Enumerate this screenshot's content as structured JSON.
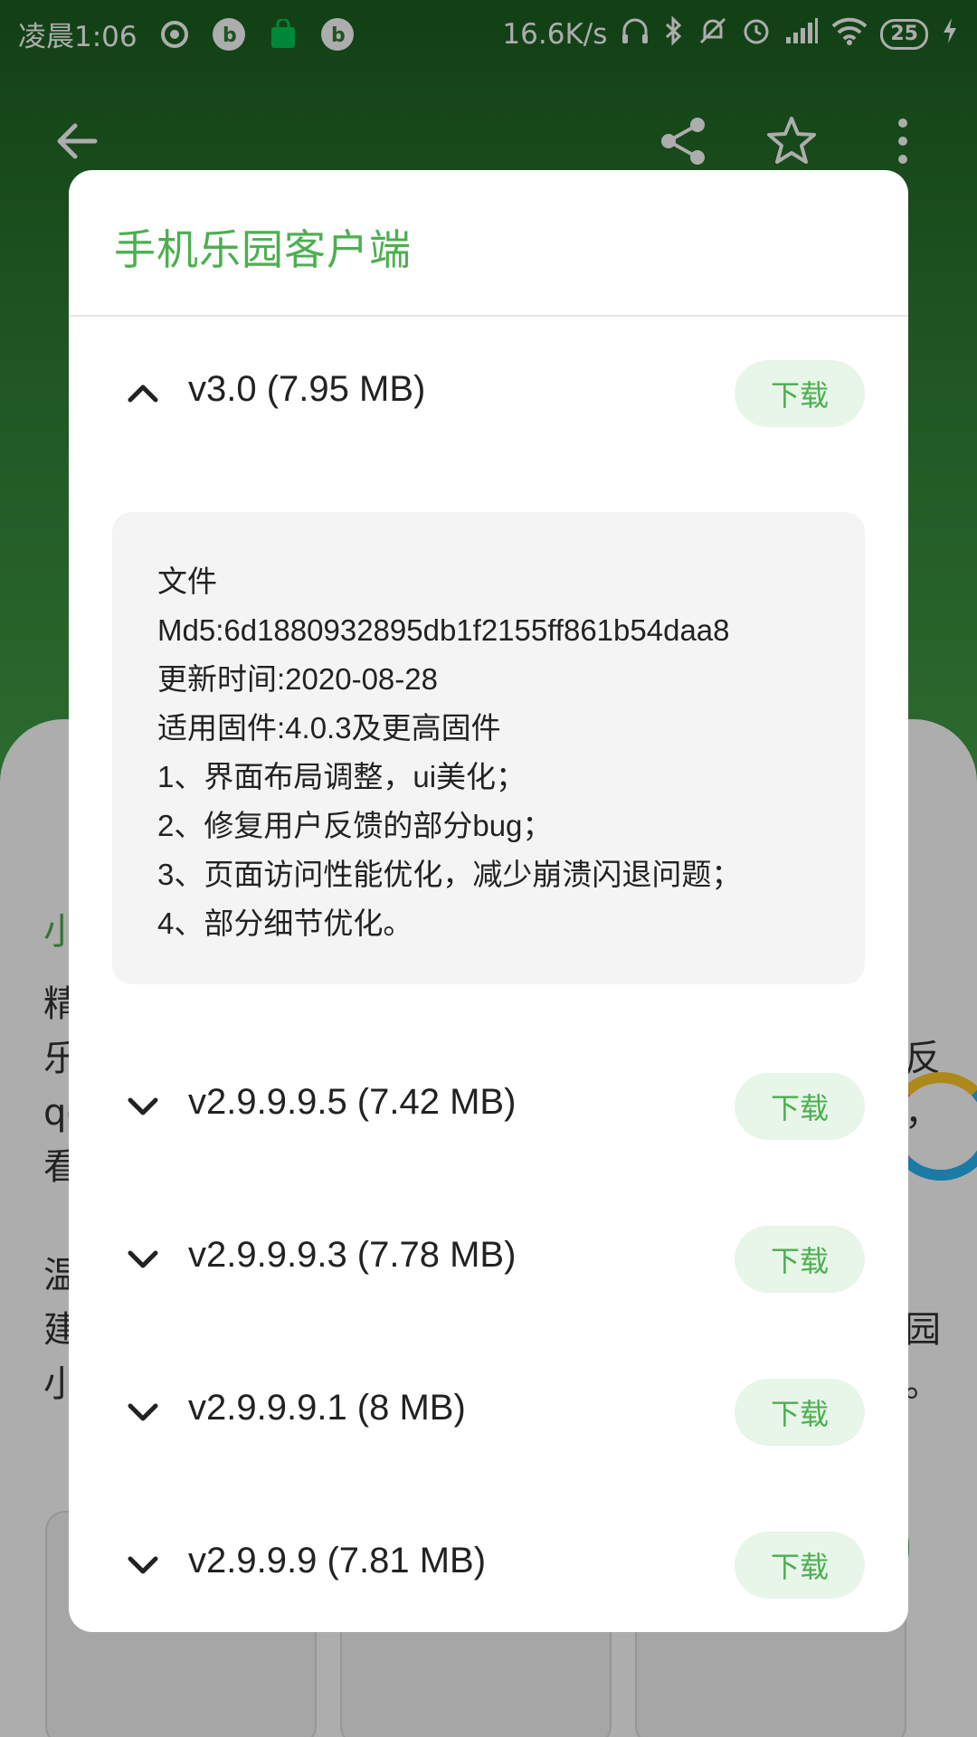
{
  "status_bar": {
    "time": "凌晨1:06",
    "speed": "16.6K/s",
    "battery": "25"
  },
  "toolbar": {
    "back_icon": "arrow-left-icon",
    "share_icon": "share-icon",
    "favorite_icon": "star-outline-icon",
    "more_icon": "more-vertical-icon"
  },
  "background": {
    "text_fragments": [
      "小",
      "精",
      "乐",
      "qq",
      "看",
      "温",
      "建",
      "小",
      "反",
      "，",
      "园",
      "。"
    ]
  },
  "dialog": {
    "title": "手机乐园客户端",
    "download_label": "下载",
    "versions": [
      {
        "label": "v3.0 (7.95 MB)",
        "expanded": true,
        "notes": [
          "文件",
          "Md5:6d1880932895db1f2155ff861b54daa8",
          "更新时间:2020-08-28",
          "适用固件:4.0.3及更高固件",
          "1、界面布局调整，ui美化；",
          "2、修复用户反馈的部分bug；",
          "3、页面访问性能优化，减少崩溃闪退问题；",
          "4、部分细节优化。"
        ]
      },
      {
        "label": "v2.9.9.9.5 (7.42 MB)",
        "expanded": false
      },
      {
        "label": "v2.9.9.9.3 (7.78 MB)",
        "expanded": false
      },
      {
        "label": "v2.9.9.9.1 (8 MB)",
        "expanded": false
      },
      {
        "label": "v2.9.9.9 (7.81 MB)",
        "expanded": false
      }
    ]
  },
  "colors": {
    "accent": "#4caf50",
    "button_bg": "#e8f5e9",
    "header_green": "#2e7d32"
  }
}
